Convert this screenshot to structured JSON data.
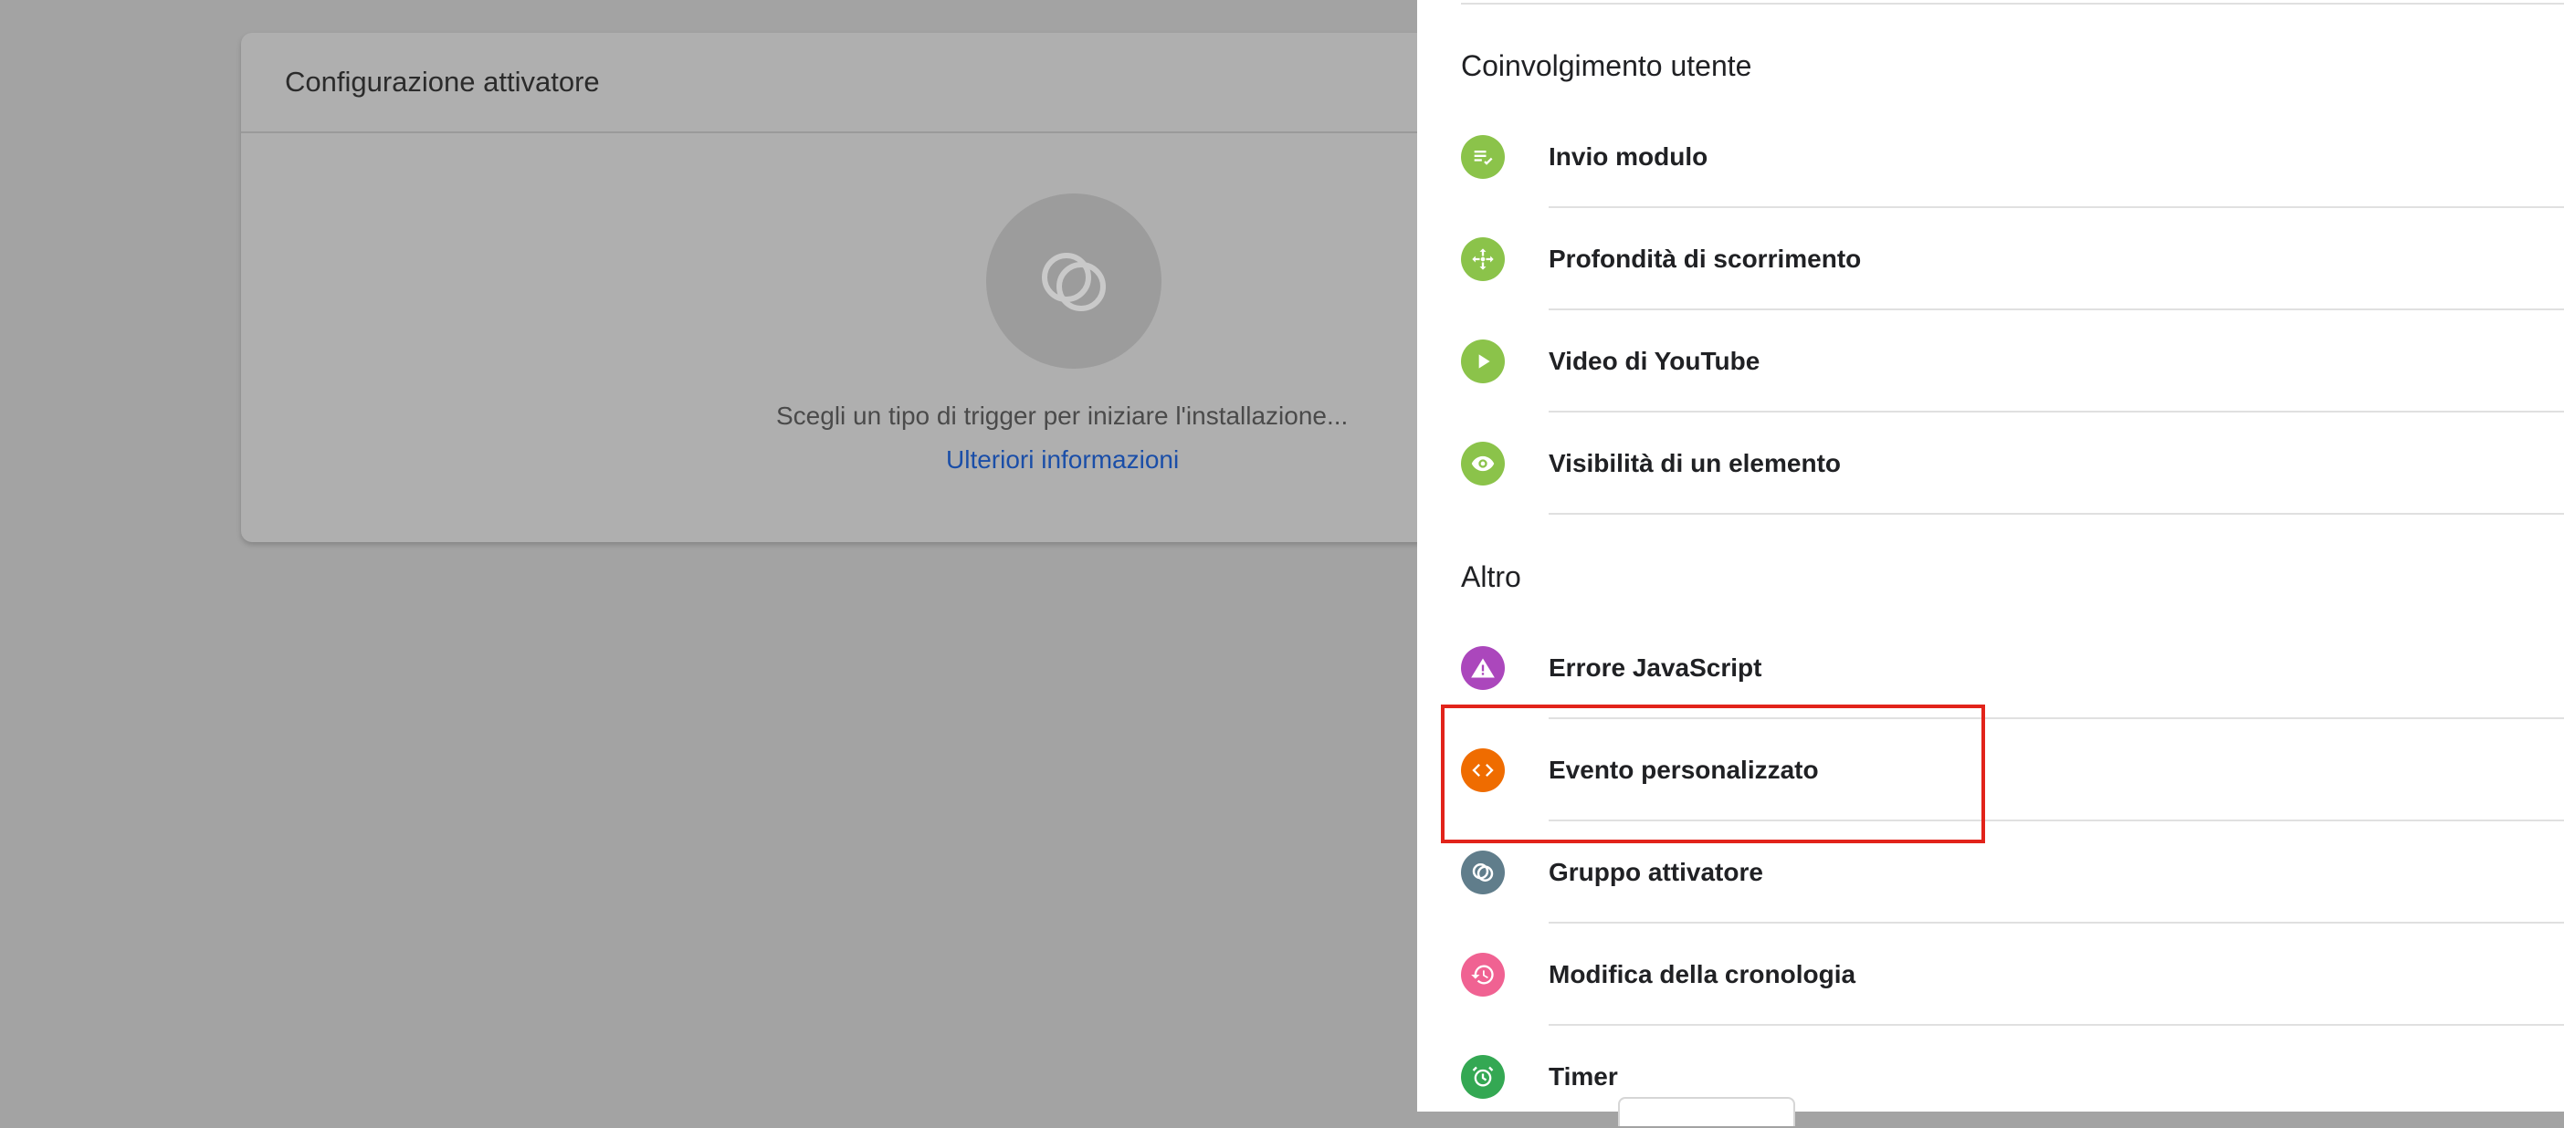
{
  "config_card": {
    "title": "Configurazione attivatore",
    "hint": "Scegli un tipo di trigger per iniziare l'installazione...",
    "learn_more": "Ulteriori informazioni"
  },
  "sections": [
    {
      "title": "Coinvolgimento utente",
      "items": [
        {
          "label": "Invio modulo",
          "icon": "form-submit-icon",
          "color": "#8bc34a"
        },
        {
          "label": "Profondità di scorrimento",
          "icon": "scroll-depth-icon",
          "color": "#8bc34a"
        },
        {
          "label": "Video di YouTube",
          "icon": "play-icon",
          "color": "#8bc34a"
        },
        {
          "label": "Visibilità di un elemento",
          "icon": "eye-icon",
          "color": "#8bc34a"
        }
      ]
    },
    {
      "title": "Altro",
      "items": [
        {
          "label": "Errore JavaScript",
          "icon": "warning-icon",
          "color": "#ab47bc"
        },
        {
          "label": "Evento personalizzato",
          "icon": "code-icon",
          "color": "#ef6c00"
        },
        {
          "label": "Gruppo attivatore",
          "icon": "trigger-group-icon",
          "color": "#607d8b"
        },
        {
          "label": "Modifica della cronologia",
          "icon": "history-icon",
          "color": "#f06292"
        },
        {
          "label": "Timer",
          "icon": "alarm-icon",
          "color": "#34a853"
        }
      ]
    }
  ],
  "colors": {
    "overlay": "#a3a3a3",
    "link": "#1a4ea8",
    "highlight": "#e2231a"
  }
}
